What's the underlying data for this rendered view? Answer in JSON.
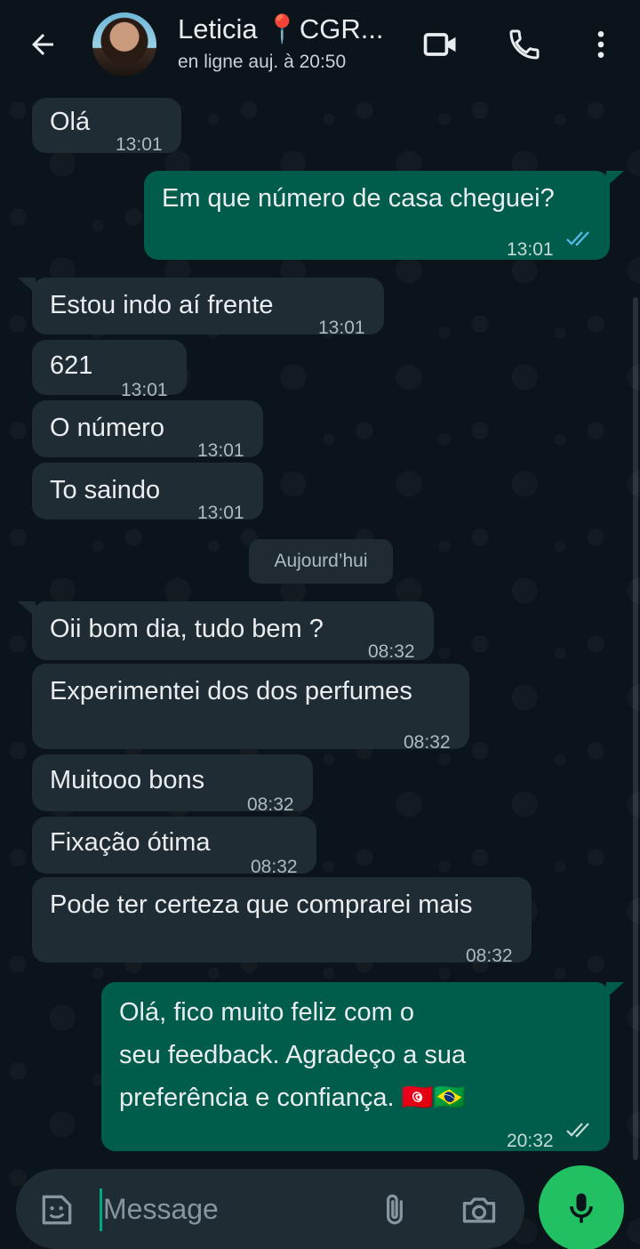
{
  "header": {
    "contact_name": "Leticia 📍CGR...",
    "status": "en ligne auj. à 20:50"
  },
  "messages": [
    {
      "dir": "in",
      "text": "Olá",
      "time": "13:01"
    },
    {
      "dir": "out",
      "text": "Em que número de casa cheguei?",
      "time": "13:01",
      "ticks": "read"
    },
    {
      "dir": "in",
      "text": "Estou indo aí frente",
      "time": "13:01"
    },
    {
      "dir": "in",
      "text": "621",
      "time": "13:01"
    },
    {
      "dir": "in",
      "text": "O número",
      "time": "13:01"
    },
    {
      "dir": "in",
      "text": "To saindo",
      "time": "13:01"
    },
    {
      "dir": "in",
      "text": "Oii bom dia, tudo bem ?",
      "time": "08:32"
    },
    {
      "dir": "in",
      "text": "Experimentei dos dos perfumes",
      "time": "08:32"
    },
    {
      "dir": "in",
      "text": "Muitooo bons",
      "time": "08:32"
    },
    {
      "dir": "in",
      "text": "Fixação ótima",
      "time": "08:32"
    },
    {
      "dir": "in",
      "text": "Pode ter certeza que comprarei mais",
      "time": "08:32"
    },
    {
      "dir": "out",
      "lines": [
        "Olá, fico muito feliz com o",
        "seu feedback. Agradeço a sua",
        "preferência e confiança. 🇹🇳🇧🇷"
      ],
      "time": "20:32",
      "ticks": "delivered"
    }
  ],
  "date_separator": "Aujourd’hui",
  "composer": {
    "placeholder": "Message"
  },
  "colors": {
    "background": "#0b141a",
    "incoming_bubble": "#202c33",
    "outgoing_bubble": "#005c4b",
    "mic_button": "#21c063",
    "read_ticks": "#53bdeb"
  },
  "icons": [
    "back-arrow-icon",
    "video-call-icon",
    "phone-icon",
    "more-vert-icon",
    "sticker-icon",
    "paperclip-icon",
    "camera-icon",
    "mic-icon"
  ]
}
